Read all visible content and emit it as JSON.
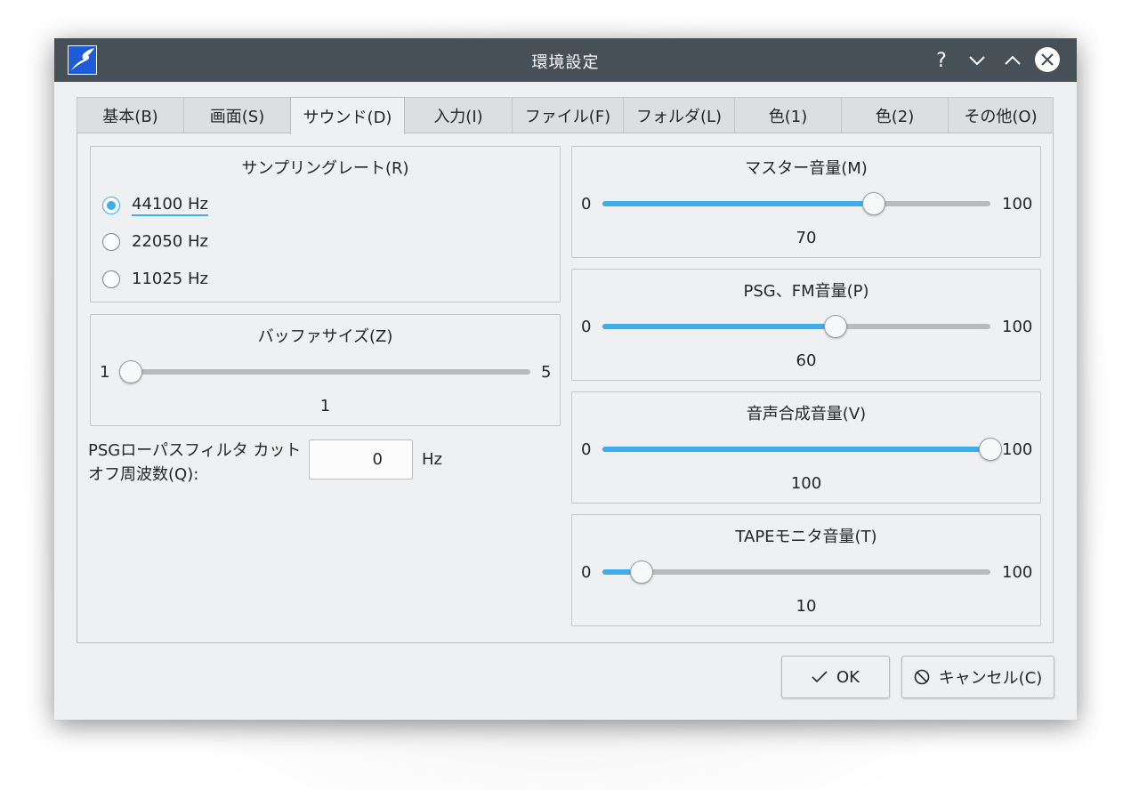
{
  "window": {
    "title": "環境設定"
  },
  "tabs": [
    {
      "label": "基本(B)",
      "active": false
    },
    {
      "label": "画面(S)",
      "active": false
    },
    {
      "label": "サウンド(D)",
      "active": true
    },
    {
      "label": "入力(I)",
      "active": false
    },
    {
      "label": "ファイル(F)",
      "active": false
    },
    {
      "label": "フォルダ(L)",
      "active": false
    },
    {
      "label": "色(1)",
      "active": false
    },
    {
      "label": "色(2)",
      "active": false
    },
    {
      "label": "その他(O)",
      "active": false
    }
  ],
  "sampling": {
    "title": "サンプリングレート(R)",
    "options": [
      {
        "label": "44100 Hz",
        "checked": true
      },
      {
        "label": "22050 Hz",
        "checked": false
      },
      {
        "label": "11025 Hz",
        "checked": false
      }
    ]
  },
  "buffer": {
    "title": "バッファサイズ(Z)",
    "min": "1",
    "max": "5",
    "value": "1",
    "fraction": 0.0
  },
  "cutoff": {
    "label": "PSGローパスフィルタ カットオフ周波数(Q):",
    "value": "0",
    "unit": "Hz"
  },
  "volumes": [
    {
      "title": "マスター音量(M)",
      "min": "0",
      "max": "100",
      "value": "70",
      "fraction": 0.7
    },
    {
      "title": "PSG、FM音量(P)",
      "min": "0",
      "max": "100",
      "value": "60",
      "fraction": 0.6
    },
    {
      "title": "音声合成音量(V)",
      "min": "0",
      "max": "100",
      "value": "100",
      "fraction": 1.0
    },
    {
      "title": "TAPEモニタ音量(T)",
      "min": "0",
      "max": "100",
      "value": "10",
      "fraction": 0.1
    }
  ],
  "buttons": {
    "ok": "OK",
    "cancel": "キャンセル(C)"
  },
  "colors": {
    "accent": "#3daee9",
    "titlebar": "#475057",
    "window": "#eff0f1"
  }
}
